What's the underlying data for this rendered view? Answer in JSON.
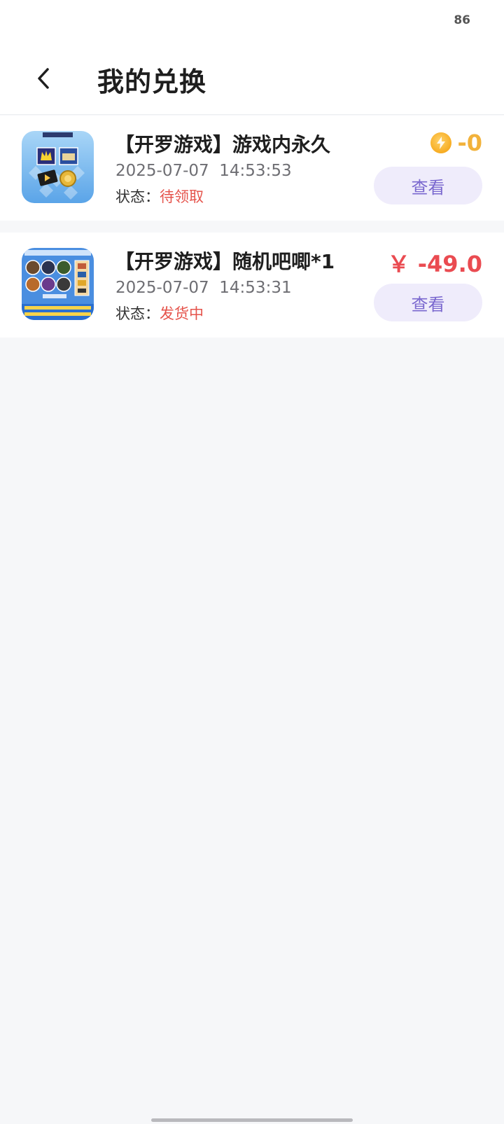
{
  "status_bar": {
    "battery": "86"
  },
  "header": {
    "title": "我的兑换"
  },
  "orders": [
    {
      "name": "【开罗游戏】游戏内永久",
      "date": "2025-07-07  14:53:53",
      "status_label": "状态：",
      "status_value": "待领取",
      "price": "-0",
      "price_type": "coin",
      "view_label": "查看"
    },
    {
      "name": "【开罗游戏】随机吧唧*1",
      "date": "2025-07-07  14:53:31",
      "status_label": "状态：",
      "status_value": "发货中",
      "price": "￥ -49.0",
      "price_type": "money",
      "view_label": "查看"
    }
  ],
  "colors": {
    "accent": "#7a68cf",
    "button_bg": "#efecfb",
    "status": "#e5534b",
    "coin": "#f2b23b",
    "money": "#ea4b51",
    "background": "#f6f7f9"
  },
  "icons": {
    "back": "chevron-left-icon",
    "coin": "lightning-coin-icon"
  }
}
